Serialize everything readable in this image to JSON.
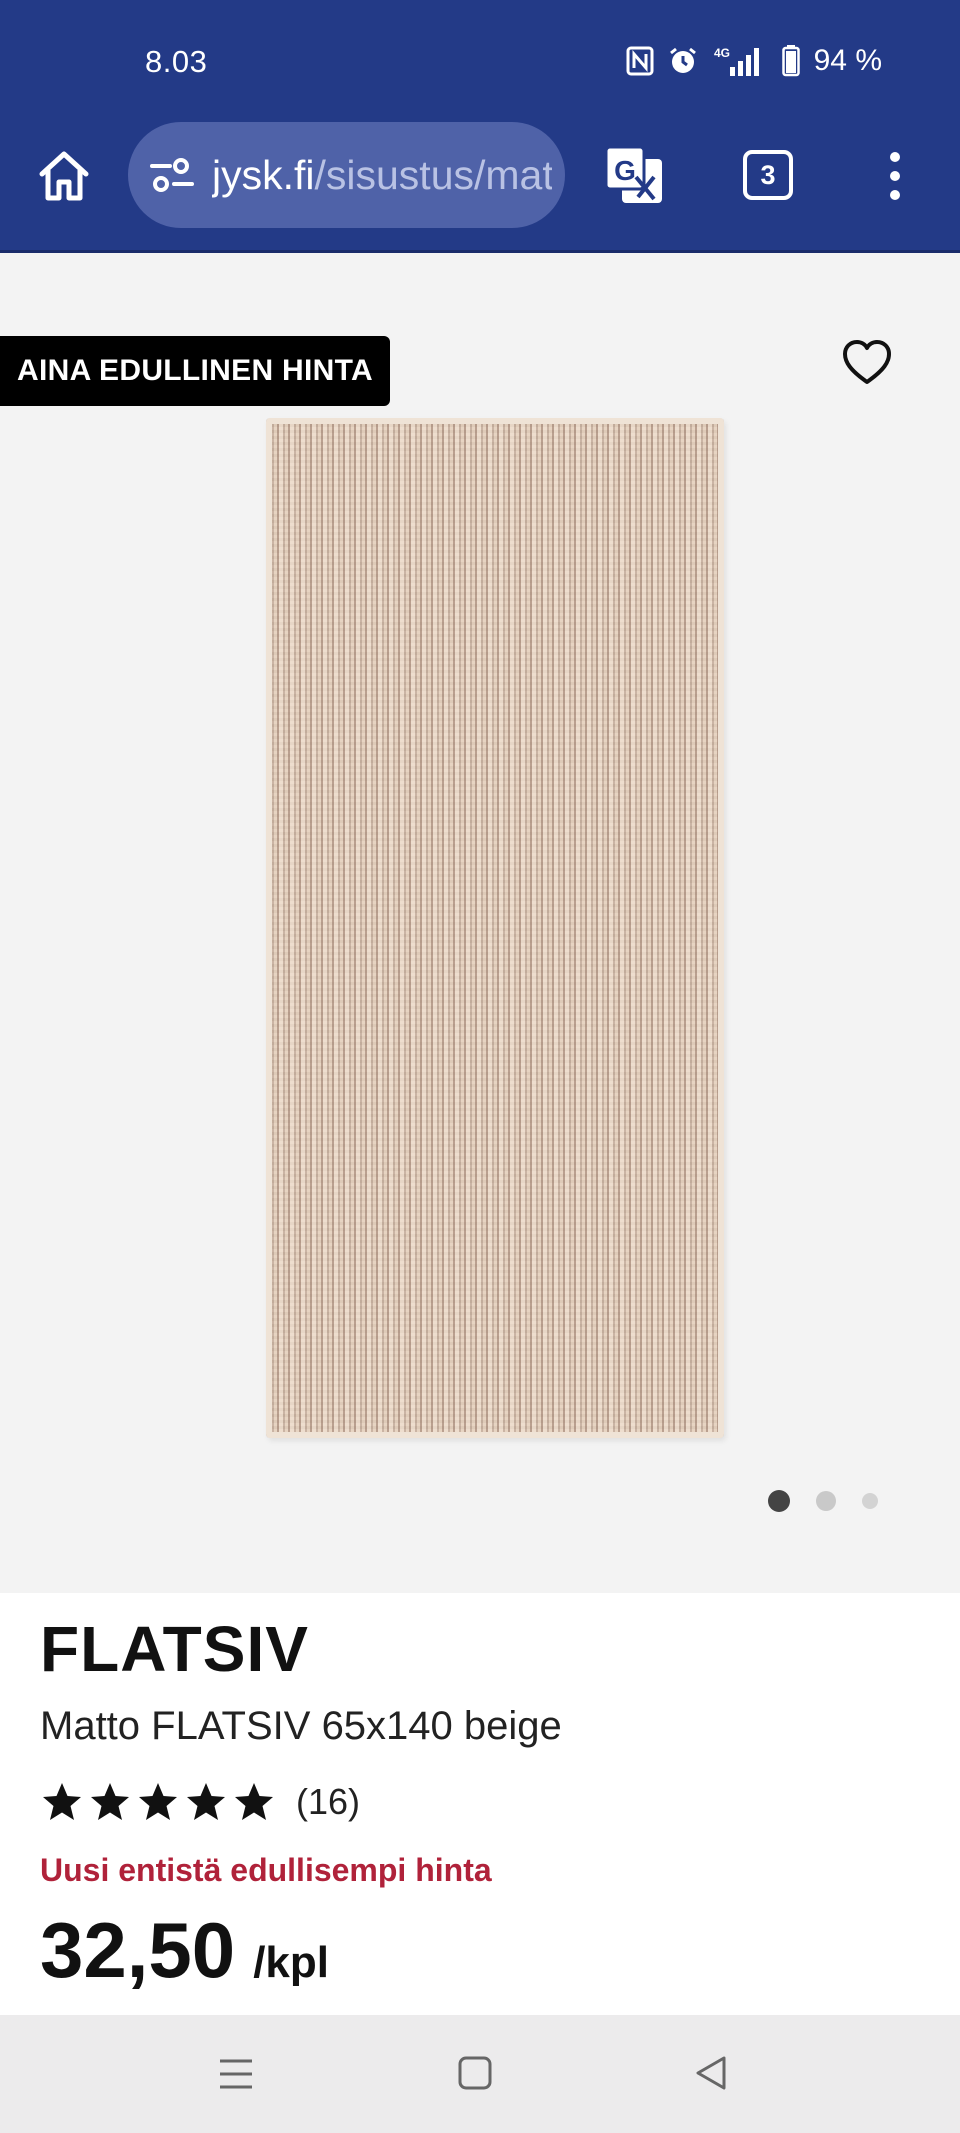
{
  "status_bar": {
    "time": "8.03",
    "network": "4G",
    "battery": "94 %",
    "icons": [
      "nfc-icon",
      "alarm-icon",
      "signal-icon",
      "battery-icon"
    ]
  },
  "browser": {
    "url_host": "jysk.fi",
    "url_path": "/sisustus/matot",
    "tab_count": "3",
    "icons": [
      "home-icon",
      "site-settings-icon",
      "translate-icon",
      "more-vert-icon"
    ]
  },
  "product": {
    "badge": "AINA EDULLINEN HINTA",
    "name": "FLATSIV",
    "description": "Matto FLATSIV 65x140 beige",
    "rating_stars": 5,
    "rating_count": "(16)",
    "price_note": "Uusi entistä edullisempi hinta",
    "price": "32,50",
    "price_unit": "/kpl",
    "gallery_active_index": 1,
    "gallery_count": 3
  },
  "colors": {
    "brand_blue": "#233a87",
    "price_note_red": "#b0223a",
    "badge_black": "#000000"
  },
  "system_nav": [
    "recents-icon",
    "home-nav-icon",
    "back-icon"
  ]
}
